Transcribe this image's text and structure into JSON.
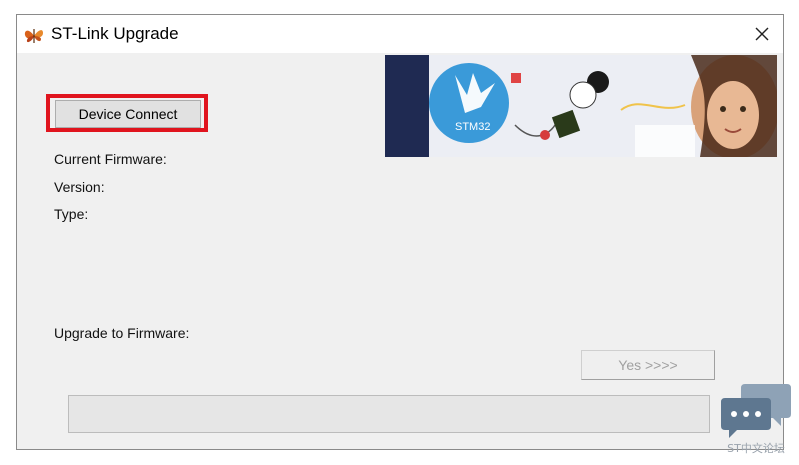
{
  "window": {
    "title": "ST-Link Upgrade",
    "app_icon": "butterfly-icon",
    "close_icon": "close-icon"
  },
  "banner": {
    "chip_label": "STM32",
    "image": "stm32-banner-girl"
  },
  "buttons": {
    "device_connect": "Device Connect",
    "yes": "Yes >>>>"
  },
  "labels": {
    "current_firmware": "Current Firmware:",
    "version": "Version:",
    "type": "Type:",
    "upgrade_to": "Upgrade to Firmware:"
  },
  "progress": {
    "value": 0
  },
  "watermark": {
    "text": "ST中文论坛",
    "icon": "chat-bubble-icon"
  },
  "colors": {
    "highlight": "#e0141e",
    "banner_navy": "#1f2a52",
    "stm_blue": "#3a9ad9"
  }
}
